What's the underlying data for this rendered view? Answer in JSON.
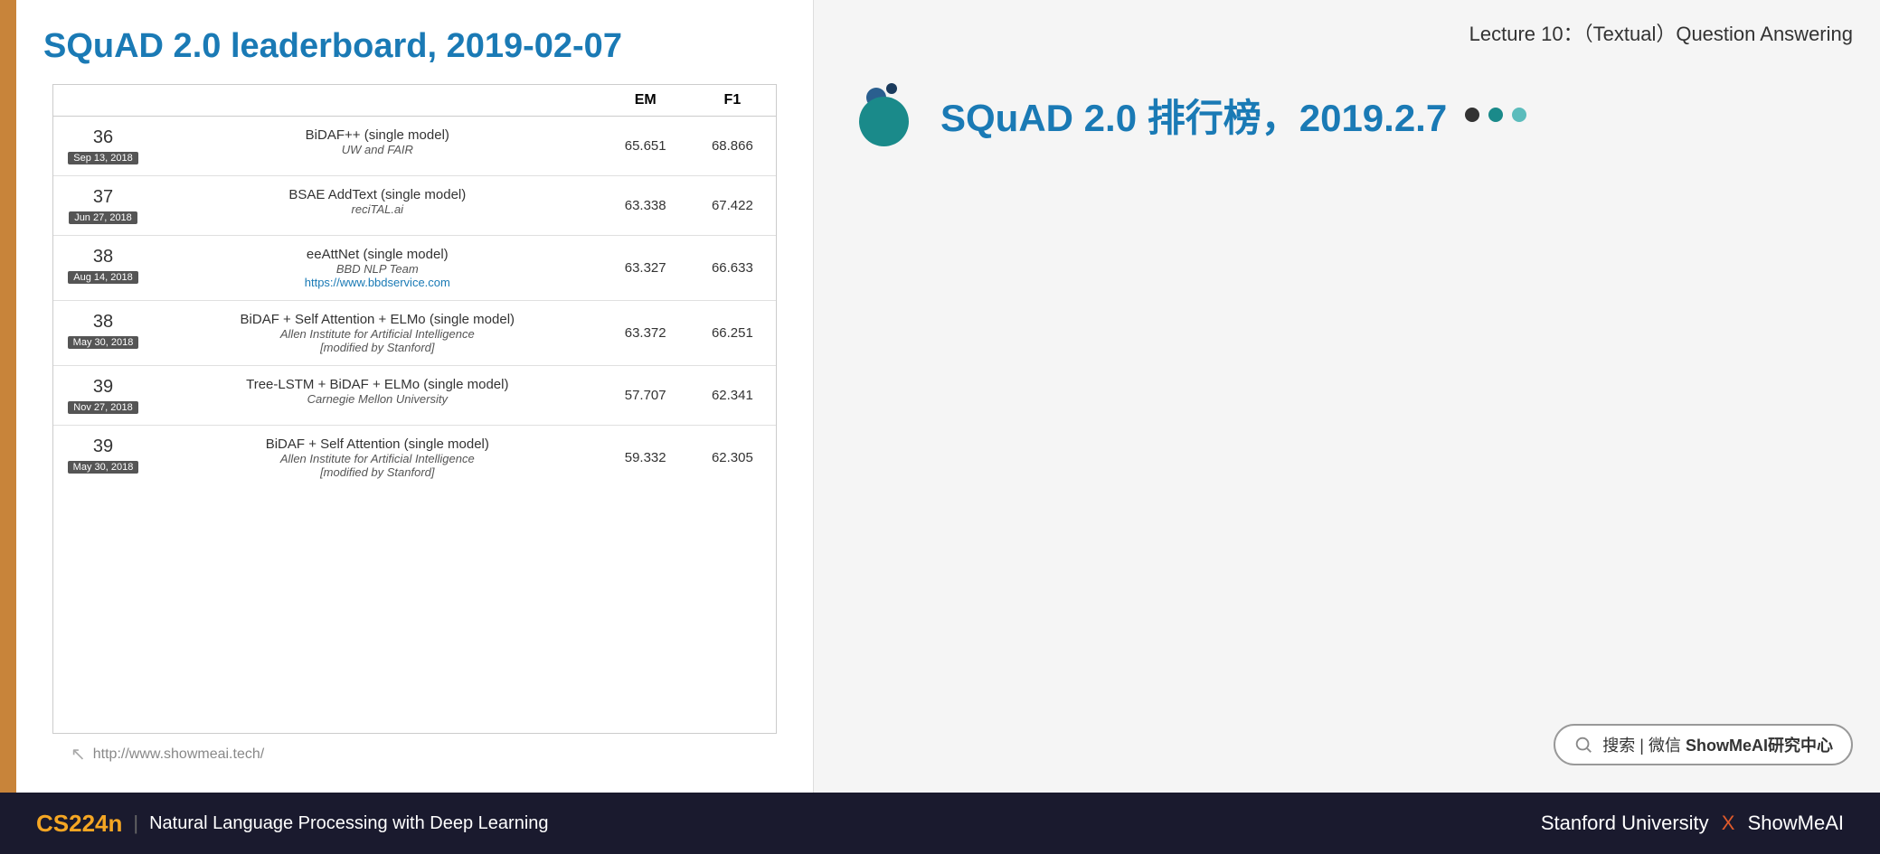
{
  "left_panel": {
    "title": "SQuAD 2.0 leaderboard, 2019-02-07",
    "table": {
      "headers": [
        "",
        "EM",
        "F1"
      ],
      "rows": [
        {
          "rank": "36",
          "date": "Sep 13, 2018",
          "model": "BiDAF++ (single model)",
          "org": "UW and FAIR",
          "link": "",
          "em": "65.651",
          "f1": "68.866"
        },
        {
          "rank": "37",
          "date": "Jun 27, 2018",
          "model": "BSAE AddText (single model)",
          "org": "reciTAL.ai",
          "link": "",
          "em": "63.338",
          "f1": "67.422"
        },
        {
          "rank": "38",
          "date": "Aug 14, 2018",
          "model": "eeAttNet (single model)",
          "org": "BBD NLP Team",
          "link": "https://www.bbdservice.com",
          "em": "63.327",
          "f1": "66.633"
        },
        {
          "rank": "38",
          "date": "May 30, 2018",
          "model": "BiDAF + Self Attention + ELMo (single model)",
          "org": "Allen Institute for Artificial Intelligence",
          "org2": "[modified by Stanford]",
          "link": "",
          "em": "63.372",
          "f1": "66.251"
        },
        {
          "rank": "39",
          "date": "Nov 27, 2018",
          "model": "Tree-LSTM + BiDAF + ELMo (single model)",
          "org": "Carnegie Mellon University",
          "link": "",
          "em": "57.707",
          "f1": "62.341"
        },
        {
          "rank": "39",
          "date": "May 30, 2018",
          "model": "BiDAF + Self Attention (single model)",
          "org": "Allen Institute for Artificial Intelligence",
          "org2": "[modified by Stanford]",
          "link": "",
          "em": "59.332",
          "f1": "62.305"
        }
      ]
    },
    "footer_url": "http://www.showmeai.tech/"
  },
  "right_panel": {
    "lecture_title": "Lecture 10：（Textual）Question Answering",
    "chinese_title": "SQuAD 2.0 排行榜，2019.2.7",
    "search_text": "搜索 | 微信 ShowMeAI研究中心"
  },
  "bottom_bar": {
    "course_code": "CS224n",
    "divider": "|",
    "course_name": "Natural Language Processing with Deep Learning",
    "right_text": "Stanford University",
    "x": "X",
    "showmeai": "ShowMeAI"
  }
}
